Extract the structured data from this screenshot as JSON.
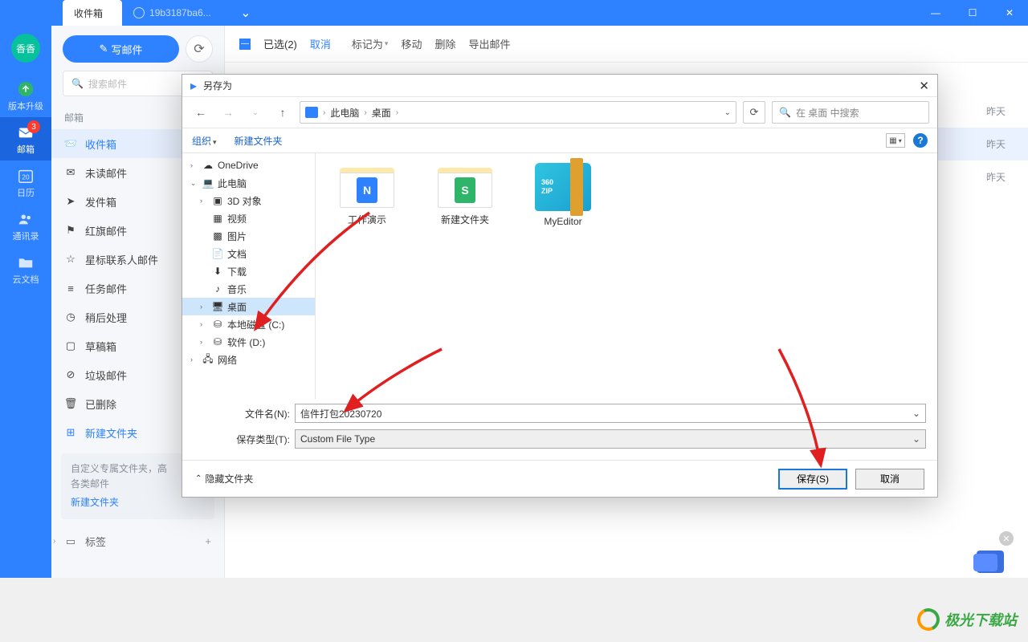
{
  "window": {
    "tabs": [
      {
        "label": "收件箱",
        "active": true
      },
      {
        "label": "19b3187ba6...",
        "active": false
      }
    ],
    "controls": {
      "min": "—",
      "max": "☐",
      "close": "✕"
    }
  },
  "rail": {
    "avatar": "香香",
    "items": [
      {
        "icon": "upgrade",
        "label": "版本升级"
      },
      {
        "icon": "mail",
        "label": "邮箱",
        "badge": "3",
        "active": true
      },
      {
        "icon": "calendar",
        "label": "日历",
        "day": "20"
      },
      {
        "icon": "contacts",
        "label": "通讯录"
      },
      {
        "icon": "cloud",
        "label": "云文档"
      }
    ]
  },
  "compose": {
    "write": "写邮件"
  },
  "search": {
    "placeholder": "搜索邮件"
  },
  "folders": {
    "section": "邮箱",
    "items": [
      {
        "icon": "inbox",
        "label": "收件箱",
        "active": true
      },
      {
        "icon": "unread",
        "label": "未读邮件"
      },
      {
        "icon": "sent",
        "label": "发件箱"
      },
      {
        "icon": "flag",
        "label": "红旗邮件"
      },
      {
        "icon": "star",
        "label": "星标联系人邮件"
      },
      {
        "icon": "task",
        "label": "任务邮件"
      },
      {
        "icon": "later",
        "label": "稍后处理"
      },
      {
        "icon": "draft",
        "label": "草稿箱"
      },
      {
        "icon": "trash",
        "label": "垃圾邮件"
      },
      {
        "icon": "deleted",
        "label": "已删除"
      },
      {
        "icon": "newfolder",
        "label": "新建文件夹",
        "link": true
      }
    ],
    "custom_hint_l1": "自定义专属文件夹，高",
    "custom_hint_l2": "各类邮件",
    "custom_action": "新建文件夹",
    "tags_label": "标签",
    "tags_plus": "+"
  },
  "toolbar": {
    "selected": "已选(2)",
    "cancel": "取消",
    "mark_as": "标记为",
    "move": "移动",
    "delete": "删除",
    "export": "导出邮件"
  },
  "mail_days": [
    "昨天",
    "昨天",
    "昨天"
  ],
  "dialog": {
    "title": "另存为",
    "path": {
      "pc": "此电脑",
      "desktop": "桌面"
    },
    "search_placeholder": "在 桌面 中搜索",
    "organize": "组织",
    "new_folder": "新建文件夹",
    "tree": [
      {
        "level": 1,
        "exp": "›",
        "icon": "cloud",
        "label": "OneDrive"
      },
      {
        "level": 1,
        "exp": "⌄",
        "icon": "pc",
        "label": "此电脑"
      },
      {
        "level": 2,
        "exp": "›",
        "icon": "3d",
        "label": "3D 对象"
      },
      {
        "level": 2,
        "exp": "",
        "icon": "video",
        "label": "视频"
      },
      {
        "level": 2,
        "exp": "",
        "icon": "pic",
        "label": "图片"
      },
      {
        "level": 2,
        "exp": "",
        "icon": "doc",
        "label": "文档"
      },
      {
        "level": 2,
        "exp": "",
        "icon": "dl",
        "label": "下载"
      },
      {
        "level": 2,
        "exp": "",
        "icon": "music",
        "label": "音乐"
      },
      {
        "level": 2,
        "exp": "›",
        "icon": "desk",
        "label": "桌面",
        "sel": true
      },
      {
        "level": 2,
        "exp": "›",
        "icon": "disk",
        "label": "本地磁盘 (C:)"
      },
      {
        "level": 2,
        "exp": "›",
        "icon": "disk",
        "label": "软件 (D:)"
      },
      {
        "level": 1,
        "exp": "›",
        "icon": "net",
        "label": "网络"
      }
    ],
    "files": [
      {
        "type": "folder-doc-blue",
        "label": "工作演示"
      },
      {
        "type": "folder-doc-green",
        "label": "新建文件夹"
      },
      {
        "type": "zip",
        "label": "MyEditor",
        "zip_text": "360\nZIP"
      }
    ],
    "filename_label": "文件名(N):",
    "filename_value": "信件打包20230720",
    "type_label": "保存类型(T):",
    "type_value": "Custom File Type",
    "hide_folders": "隐藏文件夹",
    "save": "保存(S)",
    "cancel": "取消"
  },
  "watermark": "极光下载站"
}
